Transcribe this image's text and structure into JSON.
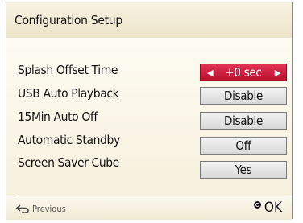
{
  "dialog": {
    "title": "Configuration Setup",
    "settings": [
      {
        "label": "Splash Offset Time",
        "value": "+0 sec"
      },
      {
        "label": "USB Auto Playback",
        "value": "Disable"
      },
      {
        "label": "15Min Auto Off",
        "value": "Disable"
      },
      {
        "label": "Automatic Standby",
        "value": "Off"
      },
      {
        "label": "Screen Saver Cube",
        "value": "Yes"
      }
    ],
    "footer": {
      "previous_label": "Previous",
      "ok_label": "OK"
    }
  },
  "colors": {
    "selected_value": "#c8183a",
    "title_bar": "#efe7cf",
    "content_bg": "#f9f5e8"
  },
  "icons": {
    "left_arrow": "left-arrow-icon",
    "right_arrow": "right-arrow-icon",
    "previous": "return-arrow-icon",
    "ok": "ok-circle-icon"
  }
}
